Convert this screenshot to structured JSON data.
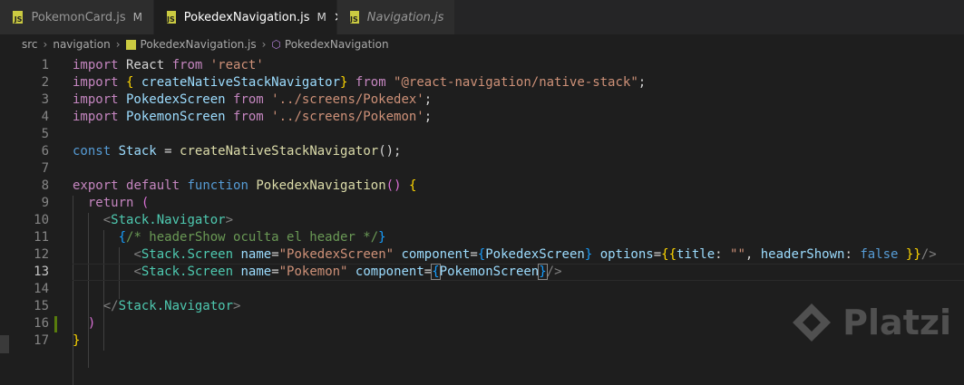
{
  "tabs": [
    {
      "label": "PokemonCard.js",
      "status": "M",
      "icon": "js-file-icon"
    },
    {
      "label": "PokedexNavigation.js",
      "status": "M",
      "icon": "js-file-icon",
      "active": true
    },
    {
      "label": "Navigation.js",
      "status": "",
      "icon": "js-file-icon"
    }
  ],
  "breadcrumb": {
    "items": [
      "src",
      "navigation",
      "PokedexNavigation.js",
      "PokedexNavigation"
    ]
  },
  "editor": {
    "current_line": 13,
    "lines": [
      {
        "num": "1"
      },
      {
        "num": "2"
      },
      {
        "num": "3"
      },
      {
        "num": "4"
      },
      {
        "num": "5"
      },
      {
        "num": "6"
      },
      {
        "num": "7"
      },
      {
        "num": "8"
      },
      {
        "num": "9"
      },
      {
        "num": "10"
      },
      {
        "num": "11"
      },
      {
        "num": "12"
      },
      {
        "num": "13"
      },
      {
        "num": "14"
      },
      {
        "num": "15"
      },
      {
        "num": "16"
      },
      {
        "num": "17"
      }
    ],
    "tokens": {
      "l1": [
        "import",
        " React ",
        "from",
        " 'react'"
      ],
      "l2": [
        "import",
        " ",
        "{",
        " createNativeStackNavigator",
        "}",
        " ",
        "from",
        " \"@react-navigation/native-stack\"",
        ";"
      ],
      "l3": [
        "import",
        " PokedexScreen ",
        "from",
        " '../screens/Pokedex'",
        ";"
      ],
      "l4": [
        "import",
        " PokemonScreen ",
        "from",
        " '../screens/Pokemon'",
        ";"
      ],
      "l6": [
        "const",
        " Stack",
        " = ",
        "createNativeStackNavigator",
        "()",
        ";"
      ],
      "l8": [
        "export",
        " ",
        "default",
        " ",
        "function",
        " ",
        "PokedexNavigation",
        "()",
        " ",
        "{"
      ],
      "l9": [
        "return",
        " ("
      ],
      "l10": [
        "<",
        "Stack.Navigator",
        ">"
      ],
      "l11": [
        "{",
        "/* headerShow oculta el header */",
        "}"
      ],
      "l12": [
        "<",
        "Stack.Screen",
        " ",
        "name",
        "=",
        "\"PokedexScreen\"",
        " ",
        "component",
        "=",
        "{",
        "PokedexScreen",
        "}",
        " ",
        "options",
        "=",
        "{{",
        "title",
        ": ",
        "\"\"",
        ", ",
        "headerShown",
        ": ",
        "false",
        " ",
        "}}",
        "/>"
      ],
      "l13": [
        "<",
        "Stack.Screen",
        " ",
        "name",
        "=",
        "\"Pokemon\"",
        " ",
        "component",
        "=",
        "{",
        "PokemonScreen",
        "}",
        "/>"
      ],
      "l15": [
        "</",
        "Stack.Navigator",
        ">"
      ],
      "l16": [
        ")"
      ],
      "l17": [
        "}"
      ]
    }
  },
  "watermark": {
    "text": "Platzi"
  },
  "colors": {
    "background": "#1e1e1e",
    "keyword_blue": "#569cd6",
    "keyword_purple": "#c586c0",
    "string": "#ce9178",
    "function": "#dcdcaa",
    "variable": "#9cdcfe",
    "comment": "#6a9955",
    "modified_gutter": "#587c0c"
  }
}
